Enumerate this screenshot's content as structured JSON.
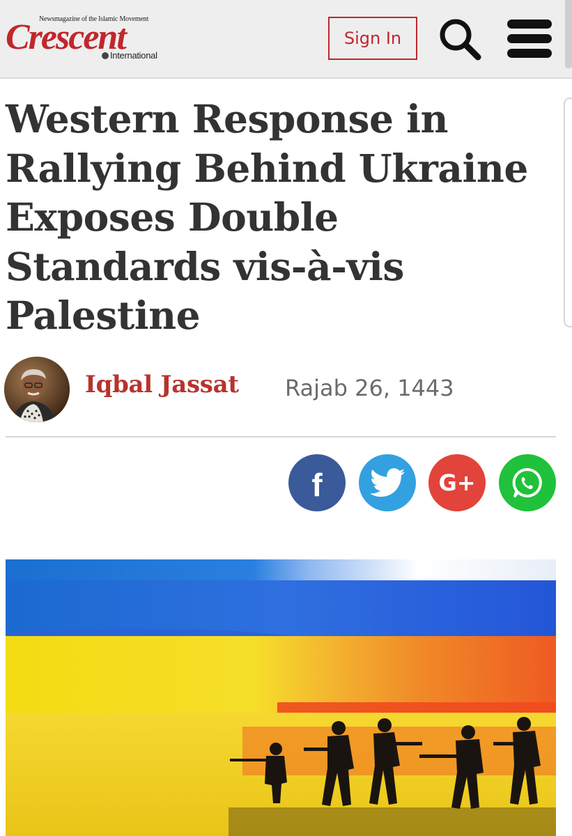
{
  "header": {
    "logo": {
      "tagline": "Newsmagazine of the Islamic Movement",
      "wordmark": "Crescent",
      "subline": "International"
    },
    "sign_in_label": "Sign In",
    "search_icon": "search-icon",
    "menu_icon": "hamburger-menu-icon",
    "accent_color": "#c0272d"
  },
  "article": {
    "title": "Western Response in Rallying Behind Ukraine Exposes Double Standards vis-à-vis Palestine",
    "author": "Iqbal Jassat",
    "date": "Rajab 26, 1443"
  },
  "share": {
    "facebook": {
      "glyph": "f",
      "color": "#3b5a9a"
    },
    "twitter": {
      "icon": "twitter-bird-icon",
      "color": "#33a1e0"
    },
    "google_plus": {
      "glyph": "G+",
      "color": "#e2433a"
    },
    "whatsapp": {
      "icon": "whatsapp-icon",
      "color": "#1fc23a"
    }
  },
  "hero_image": {
    "subject": "ukraine-russia-flags-with-soldier-silhouettes"
  }
}
